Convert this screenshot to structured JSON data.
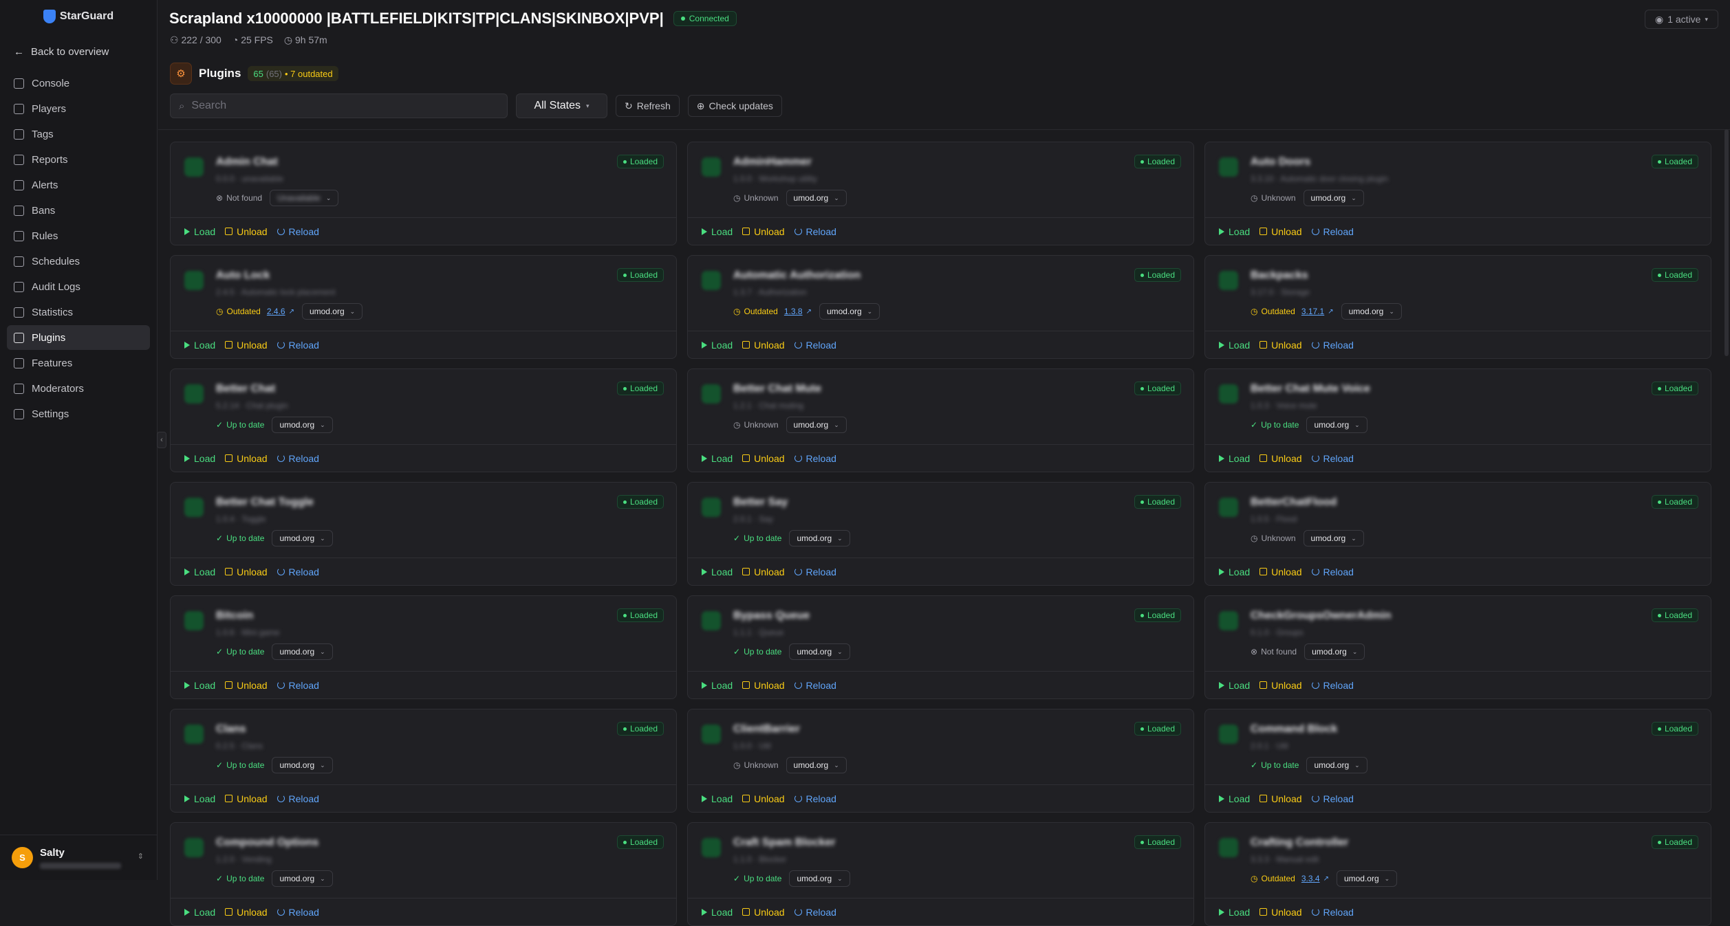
{
  "app": {
    "logo": "StarGuard"
  },
  "sidebar": {
    "back_label": "Back to overview",
    "items": [
      {
        "label": "Console",
        "icon": "terminal-icon"
      },
      {
        "label": "Players",
        "icon": "users-icon"
      },
      {
        "label": "Tags",
        "icon": "tag-icon"
      },
      {
        "label": "Reports",
        "icon": "report-icon"
      },
      {
        "label": "Alerts",
        "icon": "alert-icon"
      },
      {
        "label": "Bans",
        "icon": "ban-icon"
      },
      {
        "label": "Rules",
        "icon": "rules-icon"
      },
      {
        "label": "Schedules",
        "icon": "calendar-icon"
      },
      {
        "label": "Audit Logs",
        "icon": "clipboard-icon"
      },
      {
        "label": "Statistics",
        "icon": "chart-icon"
      },
      {
        "label": "Plugins",
        "icon": "plug-icon",
        "active": true
      },
      {
        "label": "Features",
        "icon": "zap-icon"
      },
      {
        "label": "Moderators",
        "icon": "shield-icon"
      },
      {
        "label": "Settings",
        "icon": "gear-icon"
      }
    ],
    "user": {
      "initial": "S",
      "name": "Salty"
    }
  },
  "header": {
    "title": "Scrapland x10000000 |BATTLEFIELD|KITS|TP|CLANS|SKINBOX|PVP|",
    "status": "Connected",
    "players": "222 / 300",
    "fps": "25 FPS",
    "uptime": "9h 57m",
    "active": "1 active"
  },
  "plugins": {
    "title": "Plugins",
    "count_loaded": "65",
    "count_total": "(65)",
    "outdated": "• 7 outdated"
  },
  "toolbar": {
    "search_placeholder": "Search",
    "filter_value": "All States",
    "refresh_label": "Refresh",
    "check_label": "Check updates"
  },
  "labels": {
    "loaded": "Loaded",
    "load": "Load",
    "unload": "Unload",
    "reload": "Reload"
  },
  "cards": [
    {
      "name": "Admin Chat",
      "sub": "0.0.0 · unavailable",
      "status": "Not found",
      "kind": "notfound",
      "version": "",
      "source": "Unavailable",
      "blurSource": true
    },
    {
      "name": "AdminHammer",
      "sub": "1.0.0 · Workshop utility",
      "status": "Unknown",
      "kind": "unknown",
      "version": "",
      "source": "umod.org"
    },
    {
      "name": "Auto Doors",
      "sub": "3.3.10 · Automatic door closing plugin",
      "status": "Unknown",
      "kind": "unknown",
      "version": "",
      "source": "umod.org"
    },
    {
      "name": "Auto Lock",
      "sub": "2.4.5 · Automatic lock placement",
      "status": "Outdated",
      "kind": "outdated",
      "version": "2.4.6",
      "source": "umod.org"
    },
    {
      "name": "Automatic Authorization",
      "sub": "1.3.7 · Authorization",
      "status": "Outdated",
      "kind": "outdated",
      "version": "1.3.8",
      "source": "umod.org"
    },
    {
      "name": "Backpacks",
      "sub": "3.17.0 · Storage",
      "status": "Outdated",
      "kind": "outdated",
      "version": "3.17.1",
      "source": "umod.org"
    },
    {
      "name": "Better Chat",
      "sub": "5.2.14 · Chat plugin",
      "status": "Up to date",
      "kind": "uptodate",
      "version": "",
      "source": "umod.org"
    },
    {
      "name": "Better Chat Mute",
      "sub": "1.2.1 · Chat muting",
      "status": "Unknown",
      "kind": "unknown",
      "version": "",
      "source": "umod.org"
    },
    {
      "name": "Better Chat Mute Voice",
      "sub": "1.0.3 · Voice mute",
      "status": "Up to date",
      "kind": "uptodate",
      "version": "",
      "source": "umod.org"
    },
    {
      "name": "Better Chat Toggle",
      "sub": "1.0.4 · Toggle",
      "status": "Up to date",
      "kind": "uptodate",
      "version": "",
      "source": "umod.org"
    },
    {
      "name": "Better Say",
      "sub": "2.0.1 · Say",
      "status": "Up to date",
      "kind": "uptodate",
      "version": "",
      "source": "umod.org"
    },
    {
      "name": "BetterChatFlood",
      "sub": "1.0.5 · Flood",
      "status": "Unknown",
      "kind": "unknown",
      "version": "",
      "source": "umod.org"
    },
    {
      "name": "Bitcoin",
      "sub": "1.0.6 · Mini game",
      "status": "Up to date",
      "kind": "uptodate",
      "version": "",
      "source": "umod.org"
    },
    {
      "name": "Bypass Queue",
      "sub": "1.1.1 · Queue",
      "status": "Up to date",
      "kind": "uptodate",
      "version": "",
      "source": "umod.org"
    },
    {
      "name": "CheckGroupsOwnerAdmin",
      "sub": "0.1.0 · Groups",
      "status": "Not found",
      "kind": "notfound",
      "version": "",
      "source": "umod.org"
    },
    {
      "name": "Clans",
      "sub": "0.2.5 · Clans",
      "status": "Up to date",
      "kind": "uptodate",
      "version": "",
      "source": "umod.org"
    },
    {
      "name": "ClientBarrier",
      "sub": "1.0.0 · Util",
      "status": "Unknown",
      "kind": "unknown",
      "version": "",
      "source": "umod.org"
    },
    {
      "name": "Command Block",
      "sub": "2.0.1 · Util",
      "status": "Up to date",
      "kind": "uptodate",
      "version": "",
      "source": "umod.org"
    },
    {
      "name": "Compound Options",
      "sub": "1.2.0 · Vending",
      "status": "Up to date",
      "kind": "uptodate",
      "version": "",
      "source": "umod.org"
    },
    {
      "name": "Craft Spam Blocker",
      "sub": "1.1.0 · Blocker",
      "status": "Up to date",
      "kind": "uptodate",
      "version": "",
      "source": "umod.org"
    },
    {
      "name": "Crafting Controller",
      "sub": "3.3.3 · Manual edit",
      "status": "Outdated",
      "kind": "outdated",
      "version": "3.3.4",
      "source": "umod.org"
    }
  ]
}
